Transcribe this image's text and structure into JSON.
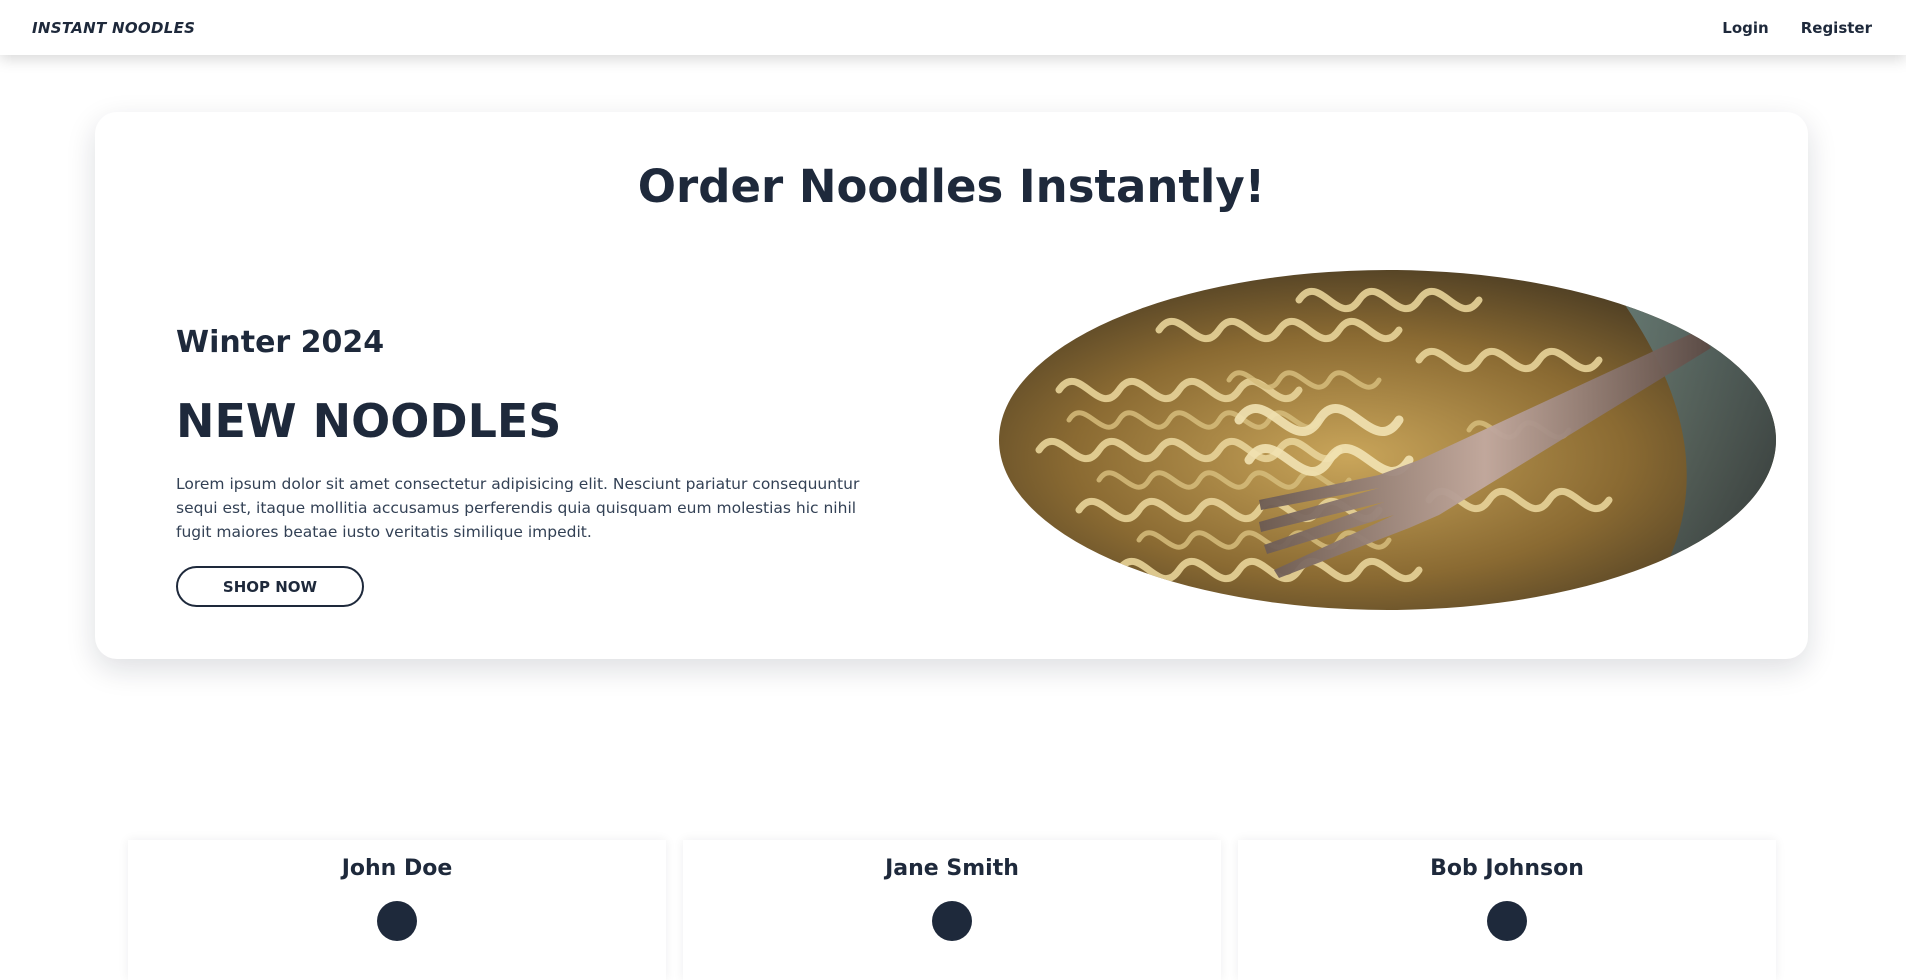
{
  "nav": {
    "brand": "INSTANT NOODLES",
    "links": [
      "Login",
      "Register"
    ]
  },
  "hero": {
    "title": "Order Noodles Instantly!",
    "season": "Winter 2024",
    "headline": "NEW NOODLES",
    "description": "Lorem ipsum dolor sit amet consectetur adipisicing elit. Nesciunt pariatur consequuntur sequi est, itaque mollitia accusamus perferendis quia quisquam eum molestias hic nihil fugit maiores beatae iusto veritatis similique impedit.",
    "cta": "SHOP NOW",
    "image": "noodle-bowl-with-fork-photo"
  },
  "testimonials": [
    {
      "name": "John Doe"
    },
    {
      "name": "Jane Smith"
    },
    {
      "name": "Bob Johnson"
    }
  ],
  "colors": {
    "text": "#1e293b",
    "body_text": "#334155",
    "background": "#ffffff",
    "avatar": "#1e293b"
  }
}
